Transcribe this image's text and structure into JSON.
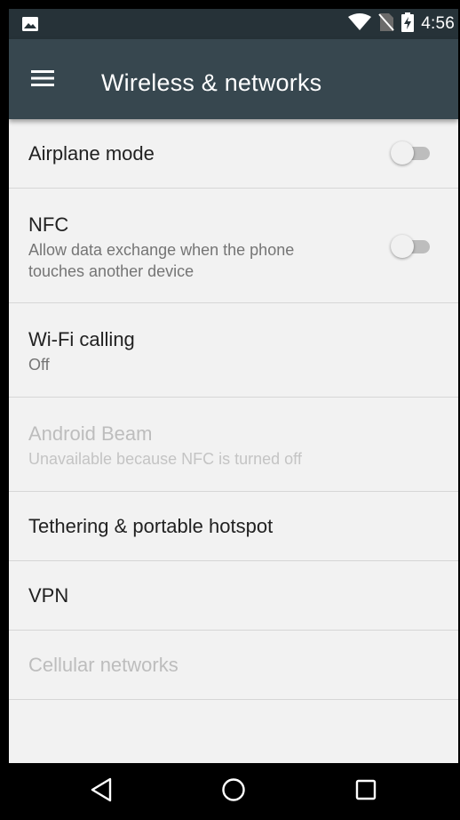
{
  "status_bar": {
    "time": "4:56",
    "icons": [
      "image-notification-icon",
      "wifi-icon",
      "no-sim-icon",
      "battery-charging-icon"
    ]
  },
  "app_bar": {
    "title": "Wireless & networks",
    "menu_icon": "menu-icon"
  },
  "settings": [
    {
      "title": "Airplane mode",
      "summary": "",
      "toggle": false,
      "enabled": true
    },
    {
      "title": "NFC",
      "summary": "Allow data exchange when the phone touches another device",
      "toggle": false,
      "enabled": true
    },
    {
      "title": "Wi-Fi calling",
      "summary": "Off",
      "enabled": true
    },
    {
      "title": "Android Beam",
      "summary": "Unavailable because NFC is turned off",
      "enabled": false
    },
    {
      "title": "Tethering & portable hotspot",
      "summary": "",
      "enabled": true
    },
    {
      "title": "VPN",
      "summary": "",
      "enabled": true
    },
    {
      "title": "Cellular networks",
      "summary": "",
      "enabled": false
    }
  ],
  "nav_bar": {
    "buttons": [
      "back-icon",
      "home-icon",
      "recents-icon"
    ]
  },
  "colors": {
    "status_bar": "#263238",
    "app_bar": "#37474f",
    "background": "#f2f2f2",
    "toggle_off_track": "#bdbdbd"
  }
}
